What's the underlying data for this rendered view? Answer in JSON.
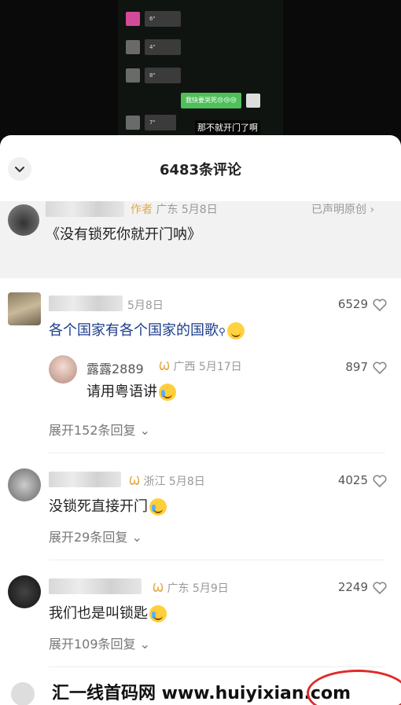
{
  "video": {
    "voice_messages": [
      "6\"",
      "4\"",
      "8\"",
      "7\""
    ],
    "green_message": "我快要哭死😢😢😢",
    "caption": "那不就开门了啊"
  },
  "sheet": {
    "title": "6483条评论"
  },
  "pinned": {
    "author_tag": "作者",
    "location_date": "广东 5月8日",
    "declared": "已声明原创 ›",
    "text": "《没有锁死你就开门呐》"
  },
  "comments": [
    {
      "date": "5月8日",
      "likes": "6529",
      "text": "各个国家有各个国家的国歌",
      "search_hint": "🔍",
      "reply": {
        "name": "露露2889",
        "location_date": "广西 5月17日",
        "likes": "897",
        "text": "请用粤语讲"
      },
      "expand": "展开152条回复 ⌄"
    },
    {
      "location_date": "浙江 5月8日",
      "likes": "4025",
      "text": "没锁死直接开门",
      "expand": "展开29条回复 ⌄"
    },
    {
      "location_date": "广东 5月9日",
      "likes": "2249",
      "text": "我们也是叫锁匙",
      "expand": "展开109条回复 ⌄"
    }
  ],
  "watermark": "汇一线首码网 www.huiyixian.com",
  "colors": {
    "author_tag": "#e2a94b",
    "link_blue": "#1c3d8c",
    "ellipse_red": "#e02a2a"
  }
}
